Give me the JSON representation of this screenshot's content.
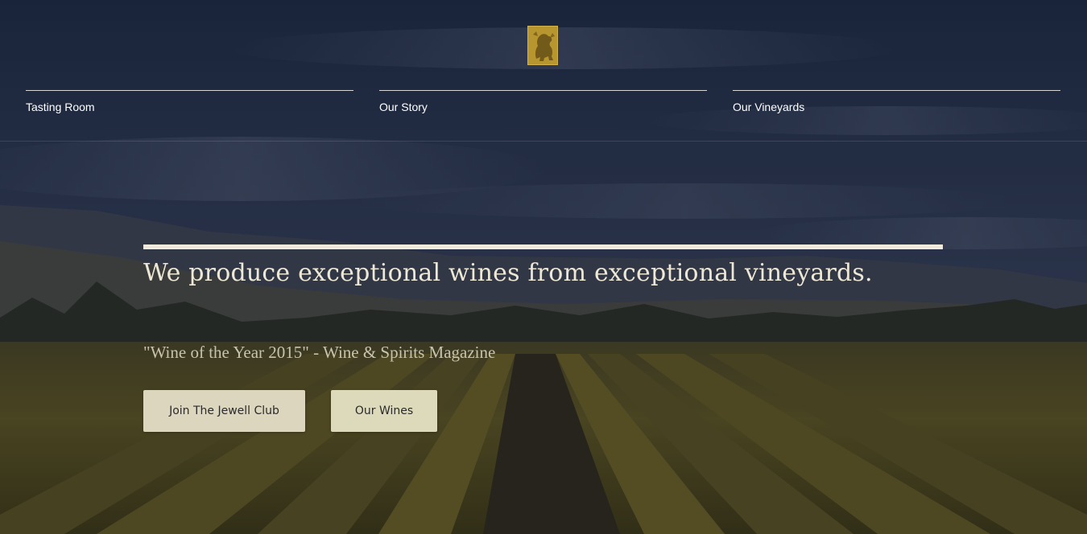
{
  "logo": {
    "icon": "lion-crest-icon",
    "color": "#b8962f"
  },
  "nav": {
    "items": [
      {
        "label": "Tasting Room"
      },
      {
        "label": "Our Story"
      },
      {
        "label": "Our Vineyards"
      }
    ]
  },
  "hero": {
    "headline": "We produce exceptional wines from exceptional vineyards.",
    "quote": "\"Wine of the Year 2015\" - Wine & Spirits Magazine",
    "buttons": {
      "club_label": "Join The Jewell Club",
      "wines_label": "Our Wines"
    },
    "background": "vineyard-landscape-photo"
  },
  "colors": {
    "accent_button": "#ddd6bf",
    "headline_text": "#ede7d6",
    "logo_gold": "#b8962f"
  }
}
